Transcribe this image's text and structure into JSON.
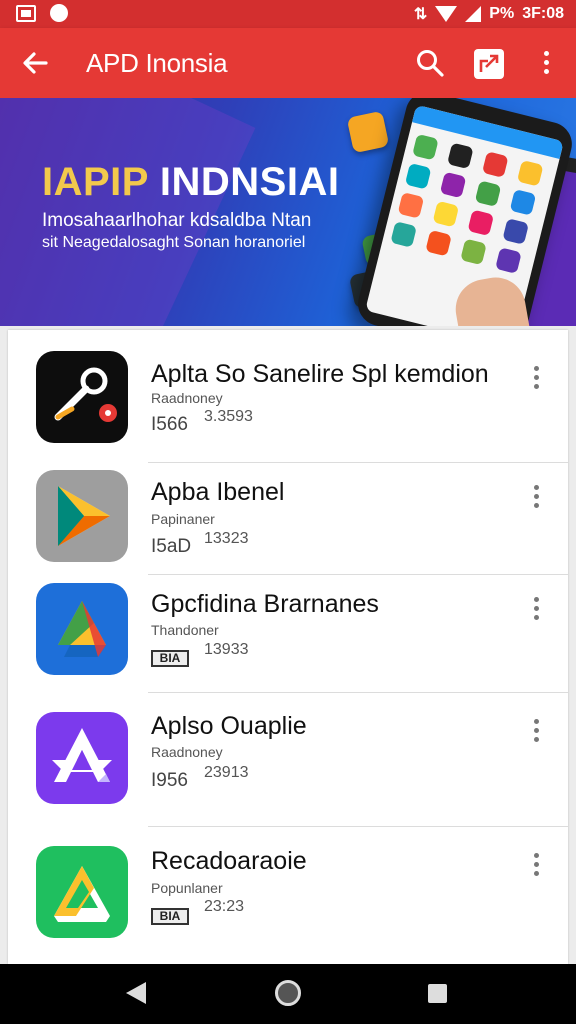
{
  "status_bar": {
    "battery": "P%",
    "time": "3F:08"
  },
  "app_bar": {
    "title": "APD Inonsia"
  },
  "banner": {
    "title_part1": "IAPIP",
    "title_part2": "INDNSIAI",
    "line1": "Imosahaarlhohar kdsaldba Ntan",
    "line2": "sit Neagedalosaght Sonan horanoriel",
    "colors": {
      "title_accent": "#f2c94c",
      "title_main": "#ffffff"
    }
  },
  "apps": [
    {
      "title": "Aplta  So Sanelire Spl kemdion",
      "category": "Raadnoney",
      "rating": "I566",
      "count": "3.3593",
      "badge": "",
      "icon": "wrench-app-icon"
    },
    {
      "title": "Apba Ibenel",
      "category": "Papinaner",
      "rating": "I5aD",
      "count": "13323",
      "badge": "",
      "icon": "play-triangle-app-icon"
    },
    {
      "title": "Gpcfidina Brarnanes",
      "category": "Thandoner",
      "rating": "",
      "count": "13933",
      "badge": "BIA",
      "icon": "drive-app-icon"
    },
    {
      "title": "Aplso Ouaplie",
      "category": "Raadnoney",
      "rating": "I956",
      "count": "23913",
      "badge": "",
      "icon": "star-shape-app-icon"
    },
    {
      "title": "Recadoaraoie",
      "category": "Popunlaner",
      "rating": "",
      "count": "23:23",
      "badge": "BIA",
      "icon": "triangle-green-app-icon"
    }
  ],
  "colors": {
    "status_bar": "#d32f2f",
    "app_bar": "#e53935",
    "nav_bar": "#000000"
  }
}
